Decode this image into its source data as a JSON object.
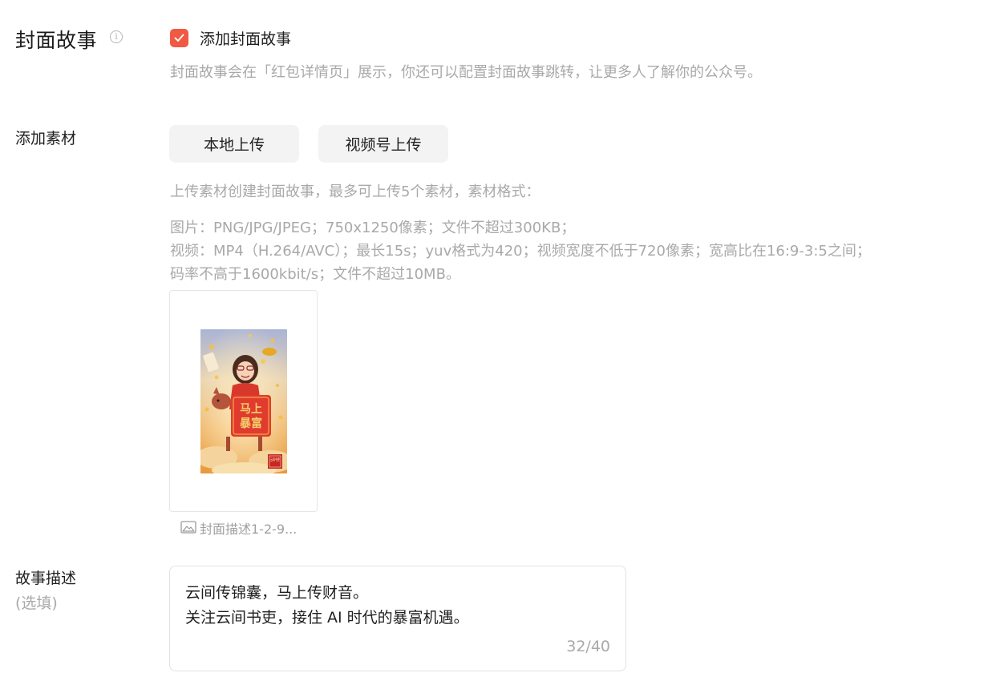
{
  "cover_story": {
    "title": "封面故事",
    "info_icon": "i",
    "checkbox_checked": true,
    "checkbox_label": "添加封面故事",
    "hint": "封面故事会在「红包详情页」展示，你还可以配置封面故事跳转，让更多人了解你的公众号。"
  },
  "material": {
    "label": "添加素材",
    "buttons": {
      "local_upload": "本地上传",
      "channels_upload": "视频号上传"
    },
    "hint": "上传素材创建封面故事，最多可上传5个素材，素材格式：",
    "spec_lines": [
      "图片：PNG/JPG/JPEG；750x1250像素；文件不超过300KB；",
      "视频：MP4（H.264/AVC）；最长15s；yuv格式为420；视频宽度不低于720像素；宽高比在16:9-3:5之间；",
      "码率不高于1600kbit/s；文件不超过10MB。"
    ],
    "thumbnail": {
      "poster_text_1": "马上",
      "poster_text_2": "暴富",
      "seal_text": "云间书吏",
      "caption": "封面描述1-2-9..."
    }
  },
  "description": {
    "label": "故事描述",
    "optional": "(选填)",
    "lines": [
      "云间传锦囊，马上传财音。",
      "关注云间书吏，接住 AI 时代的暴富机遇。"
    ],
    "counter": "32/40"
  },
  "colors": {
    "accent": "#f05a45",
    "hint": "#a9a9a9"
  }
}
